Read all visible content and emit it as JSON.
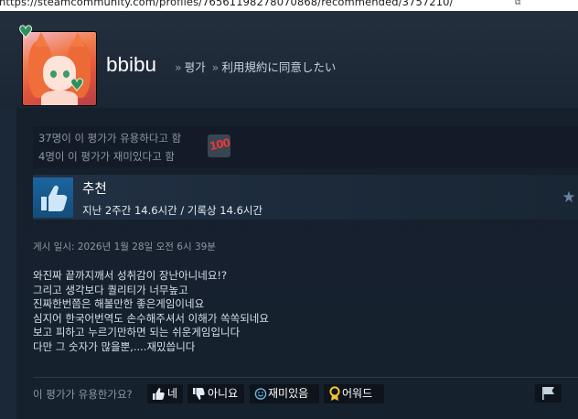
{
  "browser": {
    "url": "https://steamcommunity.com/profiles/76561198278070868/recommended/3757210/",
    "external_icon": "external-link-icon"
  },
  "header": {
    "persona_name": "bbibu",
    "breadcrumb_sep": "»",
    "breadcrumb_reviews": "평가",
    "breadcrumb_game": "利用規約に同意したい"
  },
  "rating_summary": {
    "helpful_line": "37명이 이 평가가 유용하다고 함",
    "funny_line": "4명이 이 평가가 재미있다고 함",
    "award_icon": "hundred-points-icon",
    "award_glyph": "100"
  },
  "review": {
    "verdict": "추천",
    "hours": "지난 2주간 14.6시간 / 기록상 14.6시간",
    "posted": "게시 일시: 2026년 1월 28일 오전 6시 39분",
    "lines": [
      "와진짜 끝까지깨서 성취감이 장난아니네요!?",
      "그리고 생각보다 퀄리티가 너무높고",
      "진짜한번쯤은 해볼만한 좋은게임이네요",
      "심지어 한국어번역도 손수해주셔서 이해가 쏙쏙되네요",
      "보고 피하고 누르기만하면 되는 쉬운게임입니다",
      "다만 그 숫자가 많을뿐,....재밌씁니다"
    ]
  },
  "feedback": {
    "question": "이 평가가 유용한가요?",
    "yes_label": "네",
    "no_label": "아니요",
    "funny_label": "재미있음",
    "award_label": "어워드"
  },
  "colors": {
    "background": "#1b2838",
    "panel": "#121b27",
    "thumb_blue": "#1a65a0",
    "accent_text": "#ffffff"
  }
}
